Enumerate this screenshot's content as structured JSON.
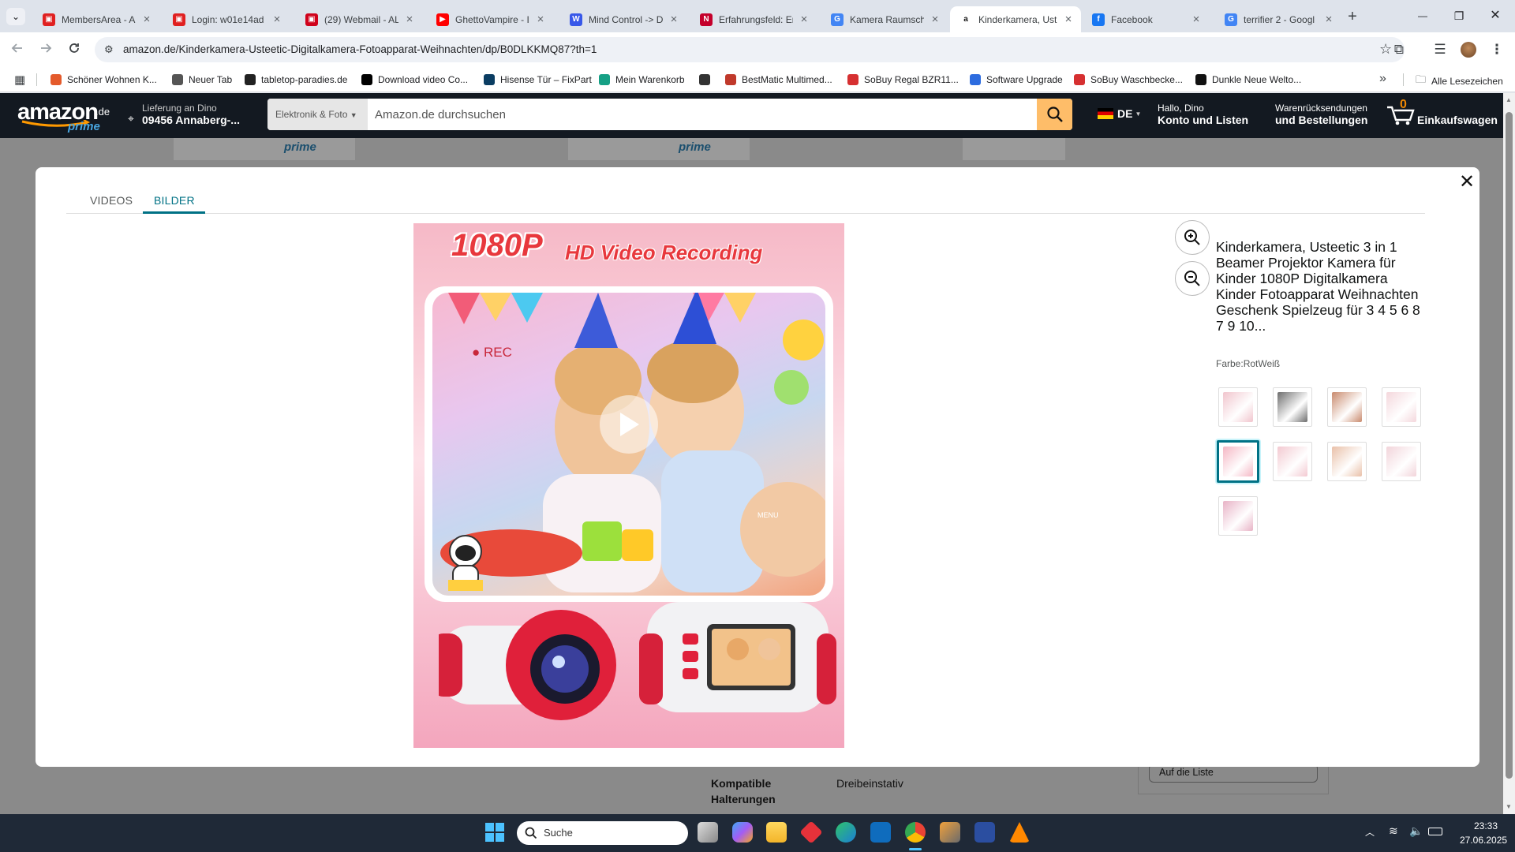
{
  "tabs": [
    {
      "title": "MembersArea - AI",
      "fav_color": "#e02020",
      "fav_glyph": "▣"
    },
    {
      "title": "Login: w01e14ad",
      "fav_color": "#e02020",
      "fav_glyph": "▣"
    },
    {
      "title": "(29) Webmail - AL",
      "fav_color": "#d0021b",
      "fav_glyph": "▣"
    },
    {
      "title": "GhettoVampire - I",
      "fav_color": "#ff0000",
      "fav_glyph": "▶"
    },
    {
      "title": "Mind Control -> D",
      "fav_color": "#3858e9",
      "fav_glyph": "W"
    },
    {
      "title": "Erfahrungsfeld: Er",
      "fav_color": "#c4002b",
      "fav_glyph": "N"
    },
    {
      "title": "Kamera Raumschi",
      "fav_color": "#4285f4",
      "fav_glyph": "G"
    },
    {
      "title": "Kinderkamera, Ust",
      "fav_color": "#ffffff",
      "fav_glyph": "a"
    },
    {
      "title": "Facebook",
      "fav_color": "#1877f2",
      "fav_glyph": "f"
    },
    {
      "title": "terrifier 2 - Googl",
      "fav_color": "#4285f4",
      "fav_glyph": "G"
    }
  ],
  "new_tab_glyph": "+",
  "window_controls": {
    "minimize": "—",
    "restore": "❐",
    "close": "✕"
  },
  "toolbar": {
    "url": "amazon.de/Kinderkamera-Usteetic-Digitalkamera-Fotoapparat-Weihnachten/dp/B0DLKKMQ87?th=1"
  },
  "bookmarks": [
    {
      "label": "Schöner Wohnen K...",
      "fav_color": "#e45a2b"
    },
    {
      "label": "Neuer Tab",
      "fav_color": "#555555"
    },
    {
      "label": "tabletop-paradies.de",
      "fav_color": "#222222"
    },
    {
      "label": "Download video Co...",
      "fav_color": "#000000"
    },
    {
      "label": "Hisense Tür – FixPart",
      "fav_color": "#0a3d62"
    },
    {
      "label": "Mein Warenkorb",
      "fav_color": "#16a085"
    },
    {
      "label": "",
      "fav_color": "#333333"
    },
    {
      "label": "BestMatic Multimed...",
      "fav_color": "#c0392b"
    },
    {
      "label": "SoBuy Regal BZR11...",
      "fav_color": "#d63031"
    },
    {
      "label": "Software Upgrade",
      "fav_color": "#2d6cdf"
    },
    {
      "label": "SoBuy Waschbecke...",
      "fav_color": "#d63031"
    },
    {
      "label": "Dunkle Neue Welto...",
      "fav_color": "#111111"
    }
  ],
  "bookmarks_more": "»",
  "all_bookmarks": "Alle Lesezeichen",
  "amazon_header": {
    "logo": "amazon",
    "logo_suffix": ".de",
    "prime": "prime",
    "delivery_line1": "Lieferung an Dino",
    "delivery_line2": "09456 Annaberg-...",
    "search_category": "Elektronik & Foto",
    "search_placeholder": "Amazon.de durchsuchen",
    "lang": "DE",
    "account_line1": "Hallo, Dino",
    "account_line2": "Konto und Listen",
    "returns_line1": "Warenrücksendungen",
    "returns_line2": "und Bestellungen",
    "cart_count": "0",
    "cart_label": "Einkaufswagen"
  },
  "modal": {
    "tabs": [
      "VIDEOS",
      "BILDER"
    ],
    "active_tab": "BILDER",
    "close_glyph": "✕",
    "image_headline_1": "1080P",
    "image_headline_2": "HD Video Recording",
    "image_rec": "● REC",
    "image_menu": "MENU",
    "product_title": "Kinderkamera, Usteetic 3 in 1 Beamer Projektor Kamera für Kinder 1080P Digitalkamera Kinder Fotoapparat Weihnachten Geschenk Spielzeug für 3 4 5 6 8 7 9 10...",
    "color_label": "Farbe:",
    "color_value": "RotWeiß",
    "thumbnails": [
      {
        "color": "#f1c5cd",
        "selected": false
      },
      {
        "color": "#6d6d6d",
        "selected": false
      },
      {
        "color": "#c98a6d",
        "selected": false
      },
      {
        "color": "#f4d7dc",
        "selected": false
      },
      {
        "color": "#f5b7c4",
        "selected": true
      },
      {
        "color": "#f3c9d1",
        "selected": false
      },
      {
        "color": "#e9c0a8",
        "selected": false
      },
      {
        "color": "#f2d4da",
        "selected": false
      },
      {
        "color": "#e8b3c6",
        "selected": false
      }
    ]
  },
  "page_behind": {
    "prime_badge_1": "prime",
    "prime_badge_2": "prime",
    "spec_label": "Kompatible Halterungen",
    "spec_value": "Dreibeinstativ",
    "list_button": "Auf die Liste"
  },
  "taskbar": {
    "search_label": "Suche",
    "time": "23:33",
    "date": "27.06.2025"
  },
  "colors": {
    "amazon_dark": "#131921",
    "amazon_search_btn": "#febd69",
    "teal_accent": "#007185",
    "taskbar": "#1f2937"
  }
}
